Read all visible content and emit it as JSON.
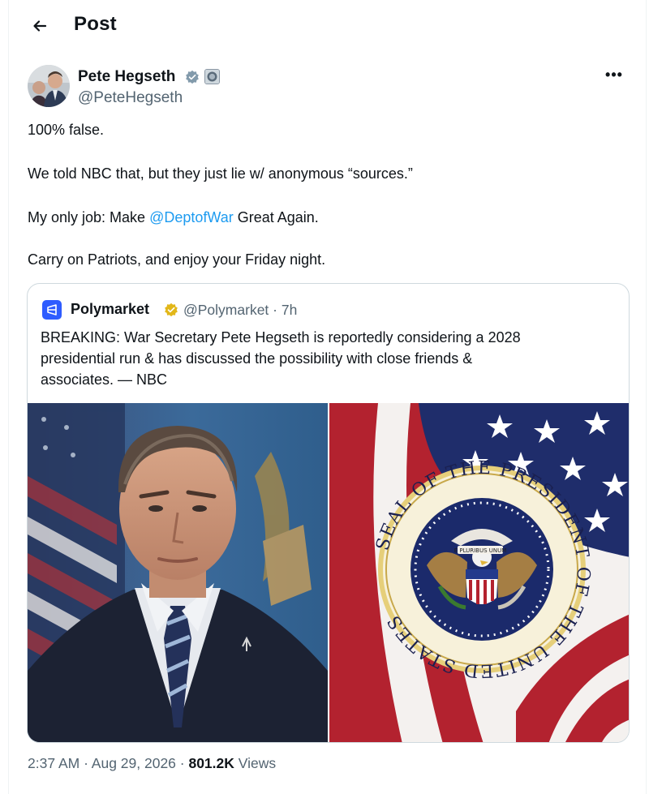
{
  "header": {
    "title": "Post",
    "back_icon": "arrow-left-icon"
  },
  "author": {
    "name": "Pete Hegseth",
    "handle": "@PeteHegseth",
    "verified_badge_color": "#829aab",
    "more_icon": "more-horizontal-icon",
    "more_label": "•••"
  },
  "post": {
    "line1": "100% false.",
    "line2": "We told NBC that, but they just lie w/ anonymous “sources.”",
    "line3_before": "My only job: Make ",
    "line3_mention": "@DeptofWar",
    "line3_after": " Great Again.",
    "line4": "Carry on Patriots, and enjoy your Friday night."
  },
  "quote": {
    "name": "Polymarket",
    "handle_time": "@Polymarket · 7h",
    "badge_color": "#e2b719",
    "logo_color": "#2e5cff",
    "body_lines": [
      "BREAKING: War Secretary Pete Hegseth is reportedly considering a 2028",
      "presidential run & has discussed the possibility with close friends &",
      "associates. — NBC"
    ],
    "seal_text": "SEAL OF THE PRESIDENT OF THE UNITED STATES",
    "seal_banner": "E PLURIBUS UNUM"
  },
  "meta": {
    "time_date": "2:37 AM · Aug 29, 2026 · ",
    "views_count": "801.2K",
    "views_label": " Views"
  },
  "colors": {
    "link": "#1d9bf0",
    "secondary_text": "#536471",
    "border": "#cfd9de"
  }
}
